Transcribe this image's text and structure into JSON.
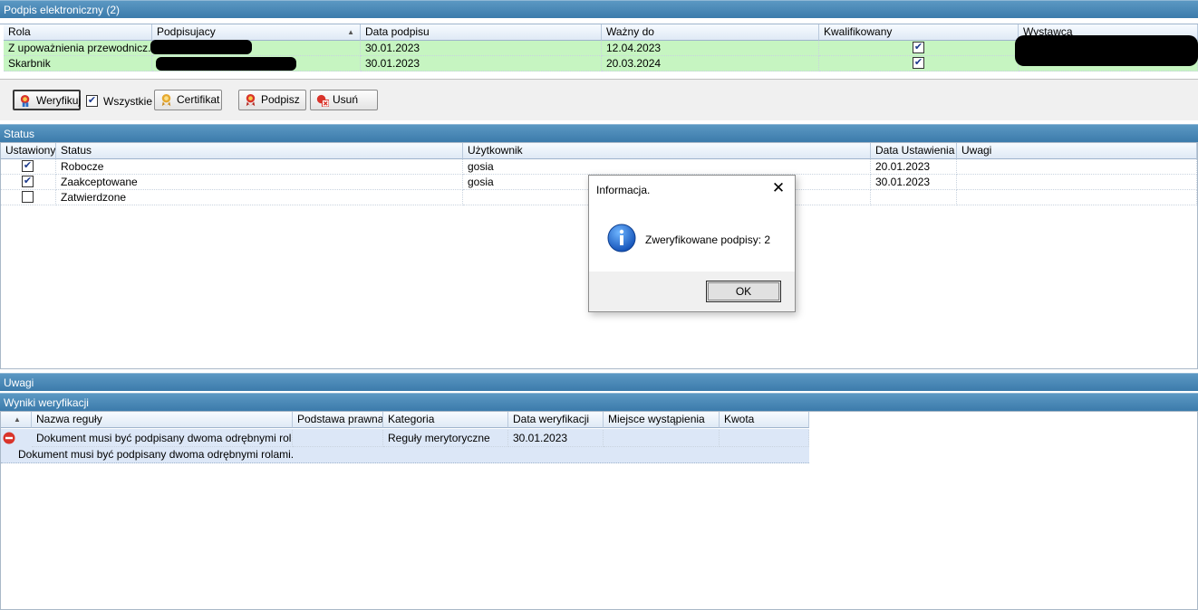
{
  "sig_section": {
    "title": "Podpis elektroniczny (2)"
  },
  "sig_grid": {
    "columns": [
      "Rola",
      "Podpisujacy",
      "Data podpisu",
      "Ważny do",
      "Kwalifikowany",
      "Wystawca"
    ],
    "rows": [
      {
        "rola": "Z upoważnienia przewodnicz...",
        "data": "30.01.2023",
        "wazny": "12.04.2023",
        "kwalifikowany": true
      },
      {
        "rola": "Skarbnik",
        "data": "30.01.2023",
        "wazny": "20.03.2024",
        "kwalifikowany": true
      }
    ]
  },
  "toolbar": {
    "verify": "Weryfikuj",
    "all_label": "Wszystkie",
    "all_checked": true,
    "certificate": "Certifikat",
    "sign": "Podpisz",
    "delete": "Usuń"
  },
  "status_section": {
    "title": "Status"
  },
  "status_grid": {
    "columns": [
      "Ustawiony",
      "Status",
      "Użytkownik",
      "Data Ustawienia",
      "Uwagi"
    ],
    "rows": [
      {
        "set": true,
        "status": "Robocze",
        "user": "gosia",
        "date": "20.01.2023",
        "notes": ""
      },
      {
        "set": true,
        "status": "Zaakceptowane",
        "user": "gosia",
        "date": "30.01.2023",
        "notes": ""
      },
      {
        "set": false,
        "status": "Zatwierdzone",
        "user": "",
        "date": "",
        "notes": ""
      }
    ]
  },
  "notes_section": {
    "title": "Uwagi"
  },
  "results_section": {
    "title": "Wyniki weryfikacji"
  },
  "results_grid": {
    "columns": [
      "Nazwa reguły",
      "Podstawa prawna",
      "Kategoria",
      "Data weryfikacji",
      "Miejsce wystąpienia",
      "Kwota"
    ],
    "row": {
      "name": "Dokument musi być podpisany dwoma odrębnymi rola...",
      "basis": "",
      "category": "Reguły merytoryczne",
      "date": "30.01.2023",
      "place": "",
      "amount": ""
    },
    "detail": "Dokument musi być podpisany dwoma odrębnymi rolami."
  },
  "dialog": {
    "title": "Informacja.",
    "message": "Zweryfikowane podpisy: 2",
    "ok": "OK"
  },
  "colors": {
    "section_bar": "#4a89b8",
    "signed_row": "#c6f5c1",
    "error": "#d9342b"
  }
}
